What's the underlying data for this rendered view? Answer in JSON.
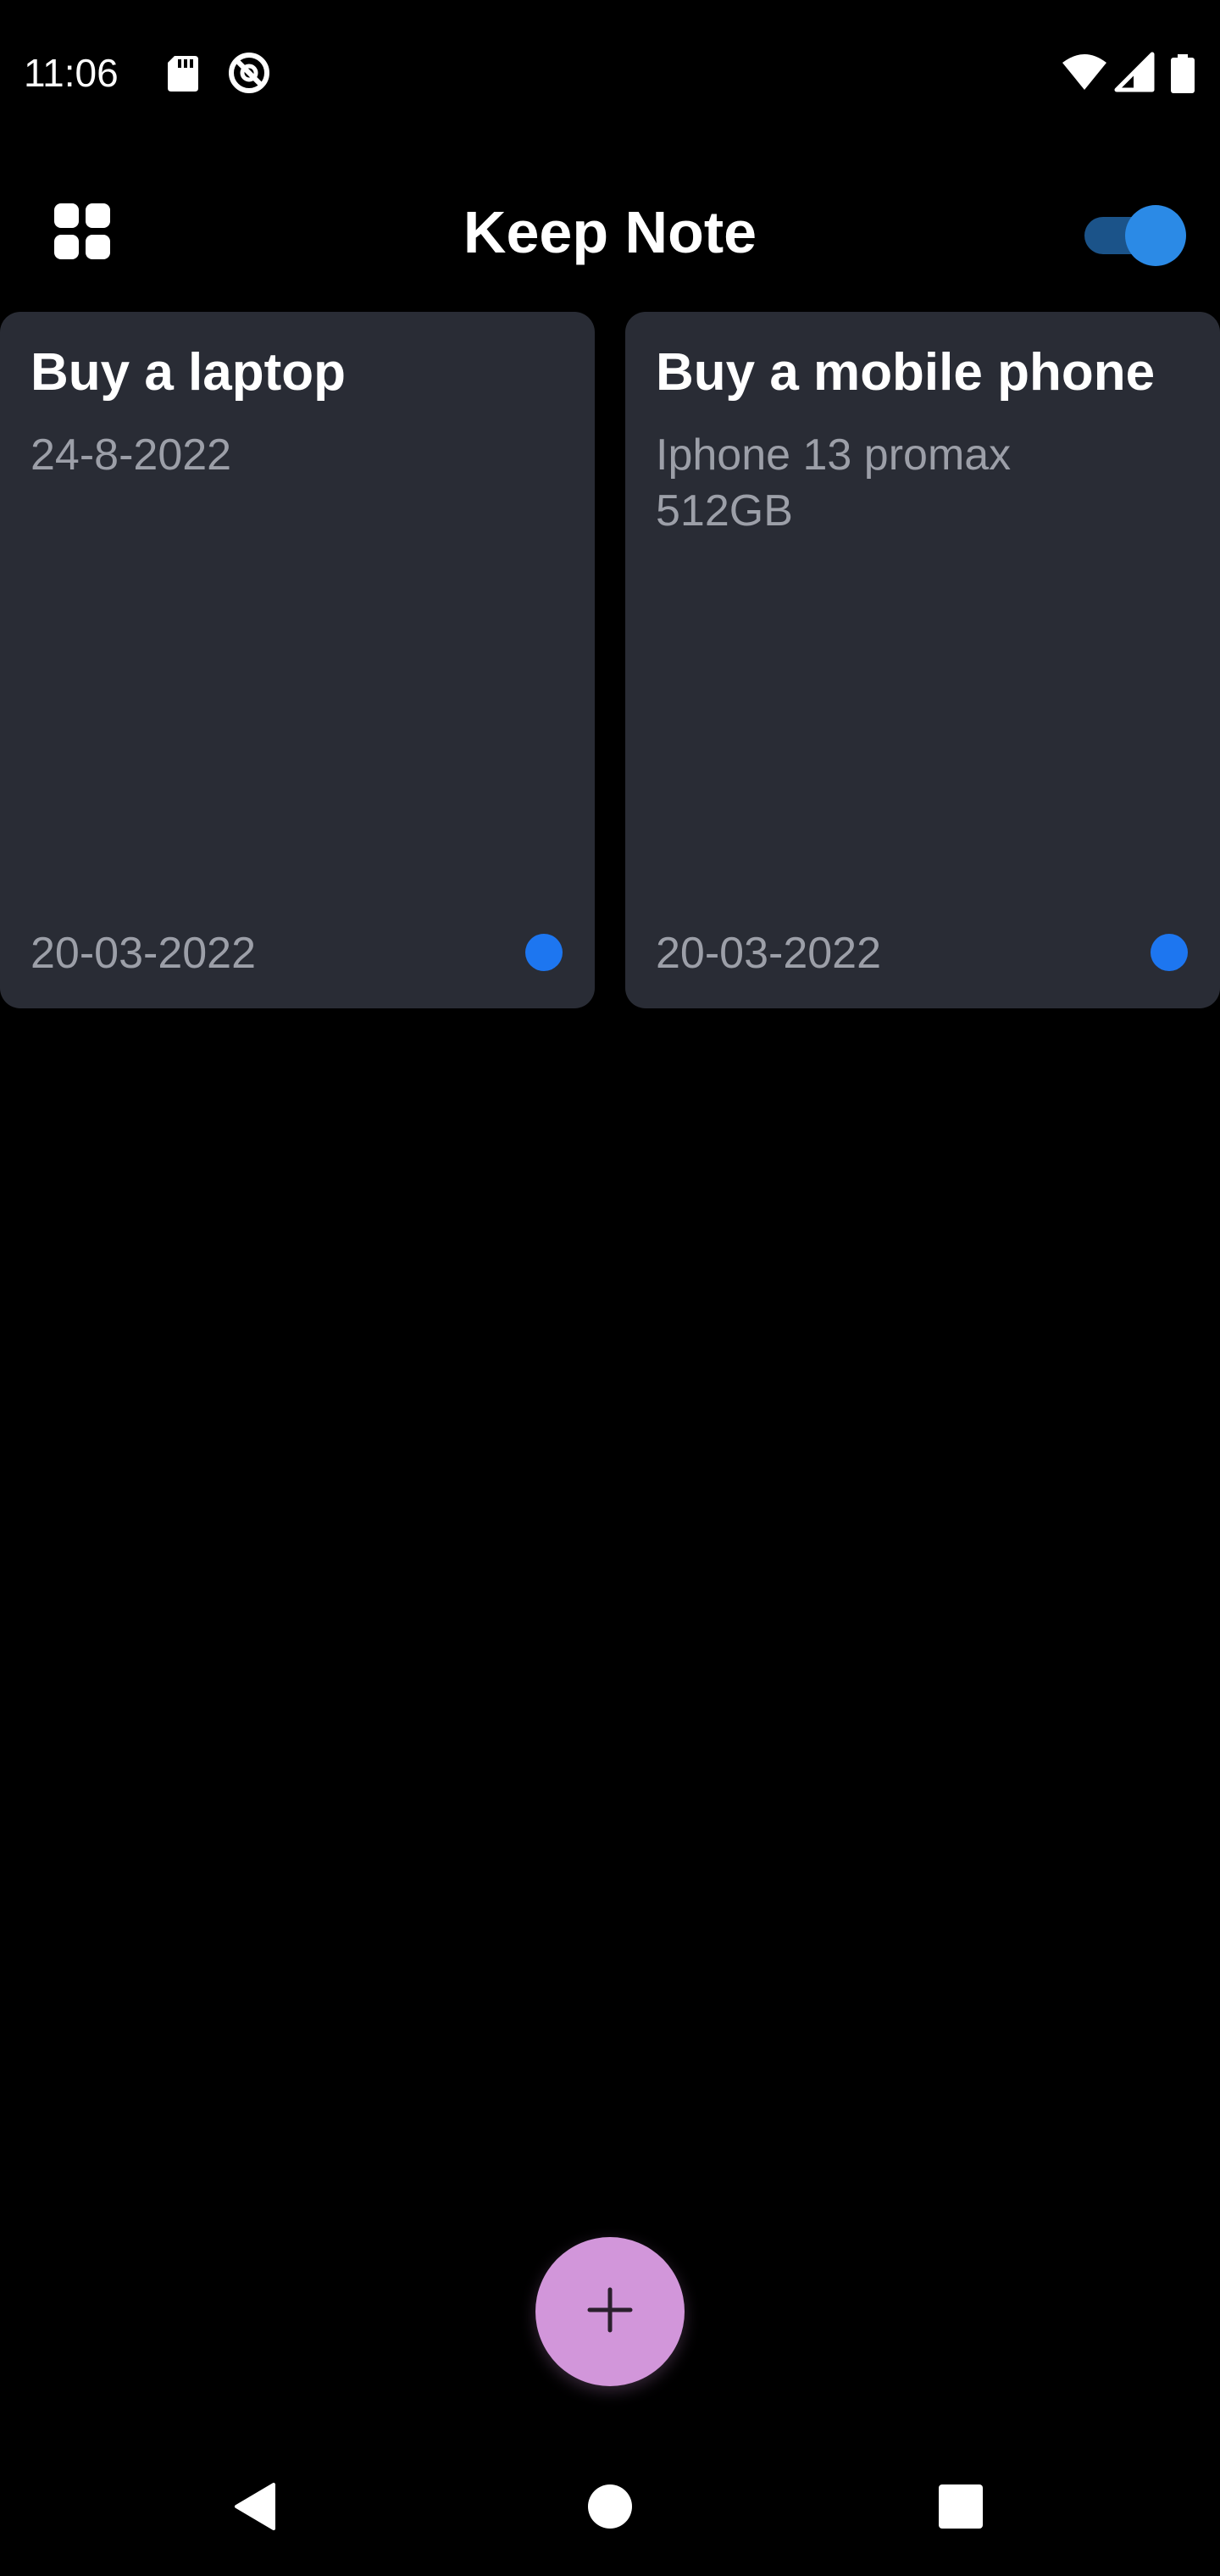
{
  "status_bar": {
    "time": "11:06",
    "icons": [
      "sd-card-icon",
      "no-sync-icon",
      "wifi-icon",
      "cell-signal-icon",
      "battery-icon"
    ]
  },
  "app_bar": {
    "title": "Keep Note",
    "layout_icon": "grid-view-icon",
    "toggle_on": true,
    "accent_color": "#2b8ae6"
  },
  "notes": [
    {
      "title": "Buy a laptop",
      "content": "24-8-2022",
      "date": "20-03-2022",
      "dot_color": "#1d76f0"
    },
    {
      "title": "Buy a mobile phone",
      "content": "Iphone 13 promax 512GB",
      "date": "20-03-2022",
      "dot_color": "#1d76f0"
    }
  ],
  "fab": {
    "icon": "plus-icon",
    "color": "#d296da"
  },
  "nav_bar": {
    "icons": [
      "back-icon",
      "home-icon",
      "recents-icon"
    ]
  }
}
